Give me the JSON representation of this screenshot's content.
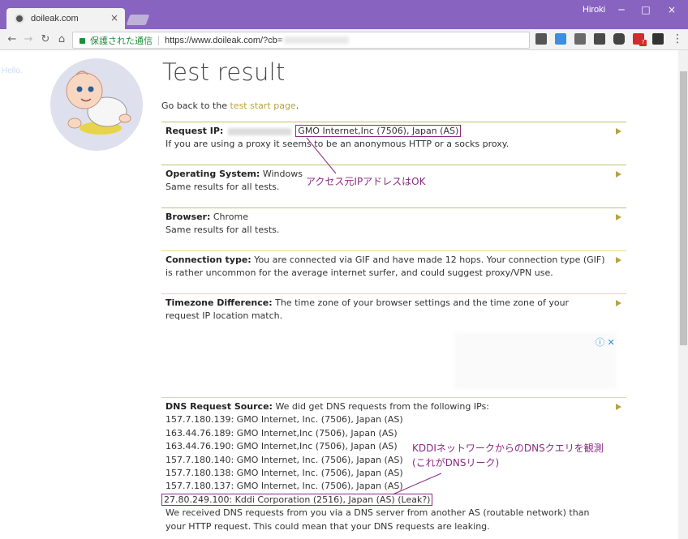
{
  "window": {
    "tab_title": "doileak.com",
    "user_name": "Hiroki",
    "close_glyph": "×",
    "minimize_glyph": "─",
    "maximize_glyph": "□"
  },
  "toolbar": {
    "security_label": "保護された通信",
    "url": "https://www.doileak.com/?cb=",
    "extension_badge": "7"
  },
  "page": {
    "title": "Test result",
    "go_back_prefix": "Go back to the ",
    "go_back_link": "test start page",
    "go_back_suffix": ".",
    "sections": {
      "request_ip": {
        "label": "Request IP:",
        "asn": "GMO Internet,Inc (7506), Japan (AS)",
        "note": "If you are using a proxy it seems to be an anonymous HTTP or a socks proxy."
      },
      "os": {
        "label": "Operating System:",
        "value": "Windows",
        "note": "Same results for all tests."
      },
      "browser": {
        "label": "Browser:",
        "value": "Chrome",
        "note": "Same results for all tests."
      },
      "connection": {
        "label": "Connection type:",
        "value": "You are connected via GIF and have made 12 hops. Your connection type (GIF) is rather uncommon for the average internet surfer, and could suggest proxy/VPN use."
      },
      "timezone": {
        "label": "Timezone Difference:",
        "value": "The time zone of your browser settings and the time zone of your request IP location match."
      },
      "dns": {
        "label": "DNS Request Source:",
        "intro": "We did get DNS requests from the following IPs:",
        "entries": [
          "157.7.180.139: GMO Internet, Inc. (7506), Japan (AS)",
          "163.44.76.189: GMO Internet,Inc (7506), Japan (AS)",
          "163.44.76.190: GMO Internet,Inc (7506), Japan (AS)",
          "157.7.180.140: GMO Internet, Inc. (7506), Japan (AS)",
          "157.7.180.138: GMO Internet, Inc. (7506), Japan (AS)",
          "157.7.180.137: GMO Internet, Inc. (7506), Japan (AS)"
        ],
        "leak_entry": "27.80.249.100: Kddi Corporation (2516), Japan (AS) (Leak?)",
        "footer": "We received DNS requests from you via a DNS server from another AS (routable network) than your HTTP request. This could mean that your DNS requests are leaking."
      }
    },
    "ad_icons": "ⓘ ✕"
  },
  "annotations": {
    "ip_ok": "アクセス元IPアドレスはOK",
    "dns_leak_line1": "KDDIネットワークからのDNSクエリを観測",
    "dns_leak_line2": "(これがDNSリーク)"
  },
  "colors": {
    "titlebar": "#8864c0",
    "accent_link": "#b7a33f",
    "annotation": "#8a2b84",
    "secure_green": "#1e8e3e"
  }
}
